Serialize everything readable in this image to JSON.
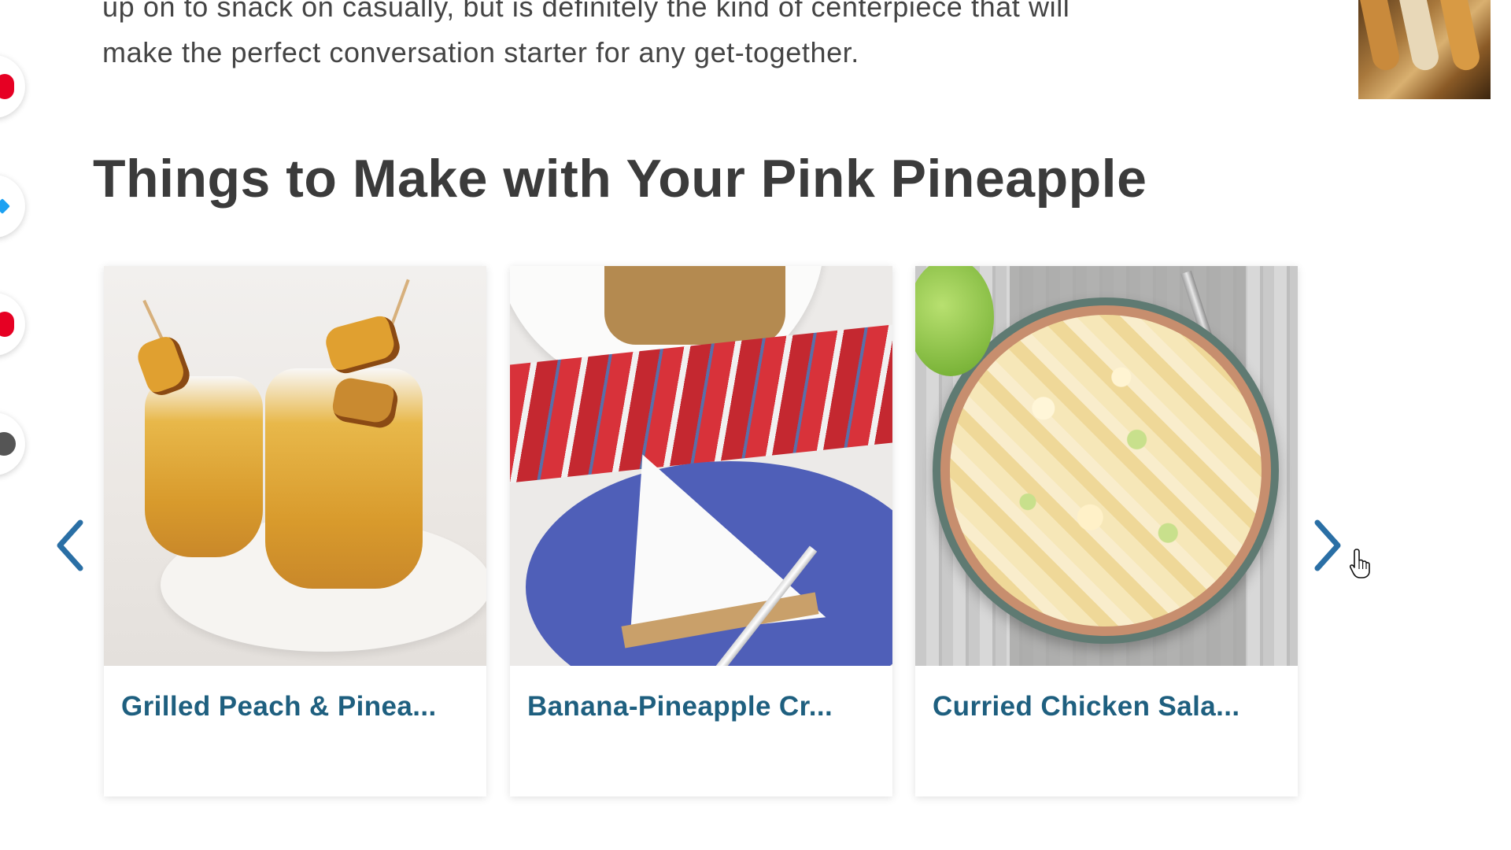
{
  "intro": {
    "line1": "up on to snack on casually, but is definitely the kind of centerpiece that will",
    "line2": "make the perfect conversation starter for any get-together."
  },
  "section": {
    "title": "Things to Make with Your Pink Pineapple"
  },
  "carousel": {
    "prev_icon": "chevron-left-icon",
    "next_icon": "chevron-right-icon",
    "cards": [
      {
        "title": "Grilled Peach & Pinea..."
      },
      {
        "title": "Banana-Pineapple Cr..."
      },
      {
        "title": "Curried Chicken Sala..."
      }
    ]
  },
  "share": {
    "icons": [
      "pinterest-icon",
      "messenger-icon",
      "flipboard-icon",
      "more-icon"
    ]
  },
  "colors": {
    "heading": "#3b3b3b",
    "card_title": "#1e5f7f",
    "arrow": "#2a6fa5",
    "body_text": "#444444"
  }
}
